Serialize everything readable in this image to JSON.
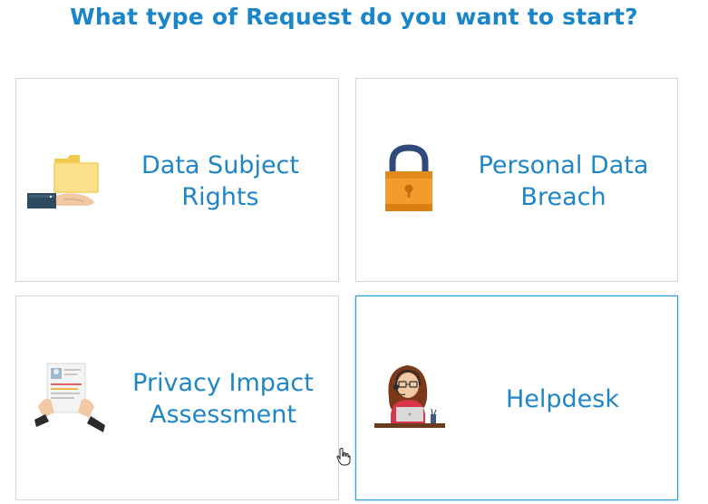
{
  "page": {
    "title": "What type of Request do you want to start?"
  },
  "cards": [
    {
      "line1": "Data Subject",
      "line2": "Rights",
      "icon": "folder-hand-icon"
    },
    {
      "line1": "Personal Data",
      "line2": "Breach",
      "icon": "padlock-icon"
    },
    {
      "line1": "Privacy Impact",
      "line2": "Assessment",
      "icon": "document-hands-icon"
    },
    {
      "line1": "Helpdesk",
      "line2": "",
      "icon": "support-agent-icon"
    }
  ],
  "colors": {
    "accent": "#1a86c8",
    "selected_border": "#2b9ad8",
    "card_border": "#d6d6d6"
  }
}
